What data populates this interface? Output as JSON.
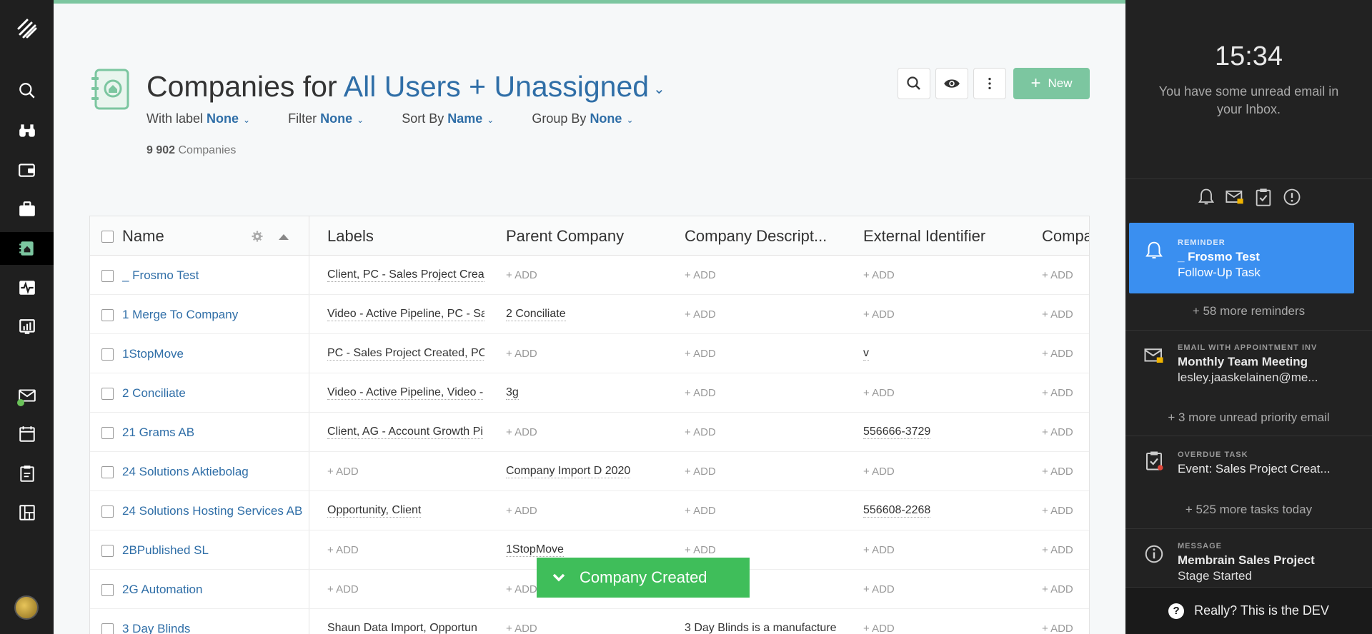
{
  "header": {
    "title_prefix": "Companies for",
    "title_scope": "All Users + Unassigned",
    "count_number": "9 902",
    "count_label": "Companies",
    "new_label": "New"
  },
  "filters": [
    {
      "label": "With label",
      "value": "None"
    },
    {
      "label": "Filter",
      "value": "None"
    },
    {
      "label": "Sort By",
      "value": "Name"
    },
    {
      "label": "Group By",
      "value": "None"
    }
  ],
  "table": {
    "columns": [
      "Name",
      "Labels",
      "Parent Company",
      "Company Descript...",
      "External Identifier",
      "Compa"
    ],
    "add_label": "+ ADD",
    "rows": [
      {
        "name": "_ Frosmo Test",
        "labels": "Client, PC - Sales Project Creat",
        "parent": "",
        "desc": "",
        "ext": "",
        "comp": ""
      },
      {
        "name": "1 Merge To Company",
        "labels": "Video - Active Pipeline, PC - Sa",
        "parent": "2 Conciliate",
        "desc": "",
        "ext": "",
        "comp": ""
      },
      {
        "name": "1StopMove",
        "labels": "PC - Sales Project Created, PC",
        "parent": "",
        "desc": "",
        "ext": "v",
        "comp": ""
      },
      {
        "name": "2 Conciliate",
        "labels": "Video - Active Pipeline, Video -",
        "parent": "3g",
        "desc": "",
        "ext": "",
        "comp": ""
      },
      {
        "name": "21 Grams AB",
        "labels": "Client, AG - Account Growth Pi",
        "parent": "",
        "desc": "",
        "ext": "556666-3729",
        "comp": ""
      },
      {
        "name": "24 Solutions Aktiebolag",
        "labels": "",
        "parent": "Company Import D 2020",
        "desc": "",
        "ext": "",
        "comp": ""
      },
      {
        "name": "24 Solutions Hosting Services AB",
        "labels": "Opportunity, Client",
        "parent": "",
        "desc": "",
        "ext": "556608-2268",
        "comp": ""
      },
      {
        "name": "2BPublished SL",
        "labels": "",
        "parent": "1StopMove",
        "desc": "",
        "ext": "",
        "comp": ""
      },
      {
        "name": "2G Automation",
        "labels": "",
        "parent": "",
        "desc": "",
        "ext": "",
        "comp": ""
      },
      {
        "name": "3 Day Blinds",
        "labels": "Shaun Data Import, Opportun",
        "parent": "",
        "desc": "3 Day Blinds is a manufacture",
        "ext": "",
        "comp": ""
      }
    ]
  },
  "toast": {
    "text": "Company Created"
  },
  "panel": {
    "clock": "15:34",
    "unread_message": "You have some unread email in your Inbox.",
    "reminder": {
      "type": "REMINDER",
      "title": "_ Frosmo Test",
      "subtitle": "Follow-Up Task"
    },
    "more_reminders": "+ 58 more reminders",
    "email": {
      "type": "EMAIL WITH APPOINTMENT INV",
      "title": "Monthly Team Meeting",
      "subtitle": "lesley.jaaskelainen@me..."
    },
    "more_email": "+ 3 more unread priority email",
    "task": {
      "type": "OVERDUE TASK",
      "title": "Event: Sales Project Creat..."
    },
    "more_tasks": "+ 525 more tasks today",
    "message": {
      "type": "MESSAGE",
      "title": "Membrain Sales Project",
      "subtitle": "Stage Started"
    },
    "footer": "Really? This is the DEV"
  },
  "colors": {
    "accent": "#2f6ea7",
    "brand_green": "#7cc6a0",
    "toast_green": "#3fbe5a",
    "reminder_blue": "#3a8ff0"
  }
}
